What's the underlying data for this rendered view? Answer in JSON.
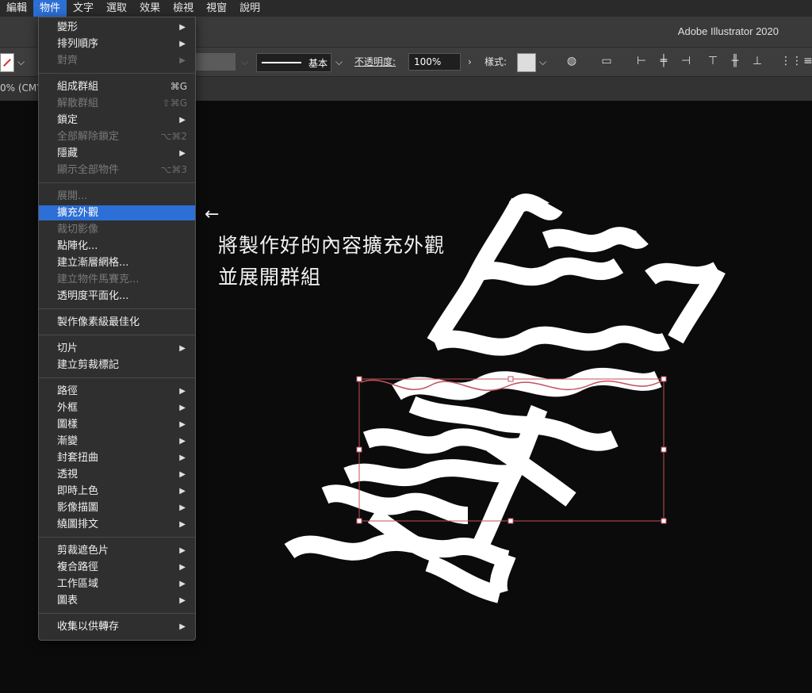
{
  "menubar": {
    "items": [
      "編輯",
      "物件",
      "文字",
      "選取",
      "效果",
      "檢視",
      "視窗",
      "說明"
    ]
  },
  "app": {
    "title": "Adobe Illustrator 2020"
  },
  "controlbar": {
    "stroke_style": "基本",
    "opacity_label": "不透明度:",
    "opacity_value": "100%",
    "style_label": "樣式:"
  },
  "document": {
    "tab_label": "0% (CMY"
  },
  "object_menu": {
    "items": [
      {
        "label": "變形",
        "submenu": true
      },
      {
        "label": "排列順序",
        "submenu": true
      },
      {
        "label": "對齊",
        "submenu": true,
        "disabled": true
      },
      {
        "label": "組成群組",
        "shortcut": "⌘G"
      },
      {
        "label": "解散群組",
        "shortcut": "⇧⌘G",
        "disabled": true
      },
      {
        "label": "鎖定",
        "submenu": true
      },
      {
        "label": "全部解除鎖定",
        "shortcut": "⌥⌘2",
        "disabled": true
      },
      {
        "label": "隱藏",
        "submenu": true
      },
      {
        "label": "顯示全部物件",
        "shortcut": "⌥⌘3",
        "disabled": true
      },
      {
        "label": "展開...",
        "disabled": true
      },
      {
        "label": "擴充外觀",
        "selected": true
      },
      {
        "label": "裁切影像",
        "disabled": true
      },
      {
        "label": "點陣化..."
      },
      {
        "label": "建立漸層網格..."
      },
      {
        "label": "建立物件馬賽克...",
        "disabled": true
      },
      {
        "label": "透明度平面化..."
      },
      {
        "label": "製作像素級最佳化"
      },
      {
        "label": "切片",
        "submenu": true
      },
      {
        "label": "建立剪裁標記"
      },
      {
        "label": "路徑",
        "submenu": true
      },
      {
        "label": "外框",
        "submenu": true
      },
      {
        "label": "圖樣",
        "submenu": true
      },
      {
        "label": "漸變",
        "submenu": true
      },
      {
        "label": "封套扭曲",
        "submenu": true
      },
      {
        "label": "透視",
        "submenu": true
      },
      {
        "label": "即時上色",
        "submenu": true
      },
      {
        "label": "影像描圖",
        "submenu": true
      },
      {
        "label": "繞圖排文",
        "submenu": true
      },
      {
        "label": "剪裁遮色片",
        "submenu": true
      },
      {
        "label": "複合路徑",
        "submenu": true
      },
      {
        "label": "工作區域",
        "submenu": true
      },
      {
        "label": "圖表",
        "submenu": true
      },
      {
        "label": "收集以供轉存",
        "submenu": true
      }
    ]
  },
  "annotation": {
    "arrow": "←",
    "line1": "將製作好的內容擴充外觀",
    "line2": "並展開群組"
  },
  "colors": {
    "highlight": "#2c6fd6",
    "selection_box": "#c0505c",
    "artwork": "#ffffff"
  }
}
